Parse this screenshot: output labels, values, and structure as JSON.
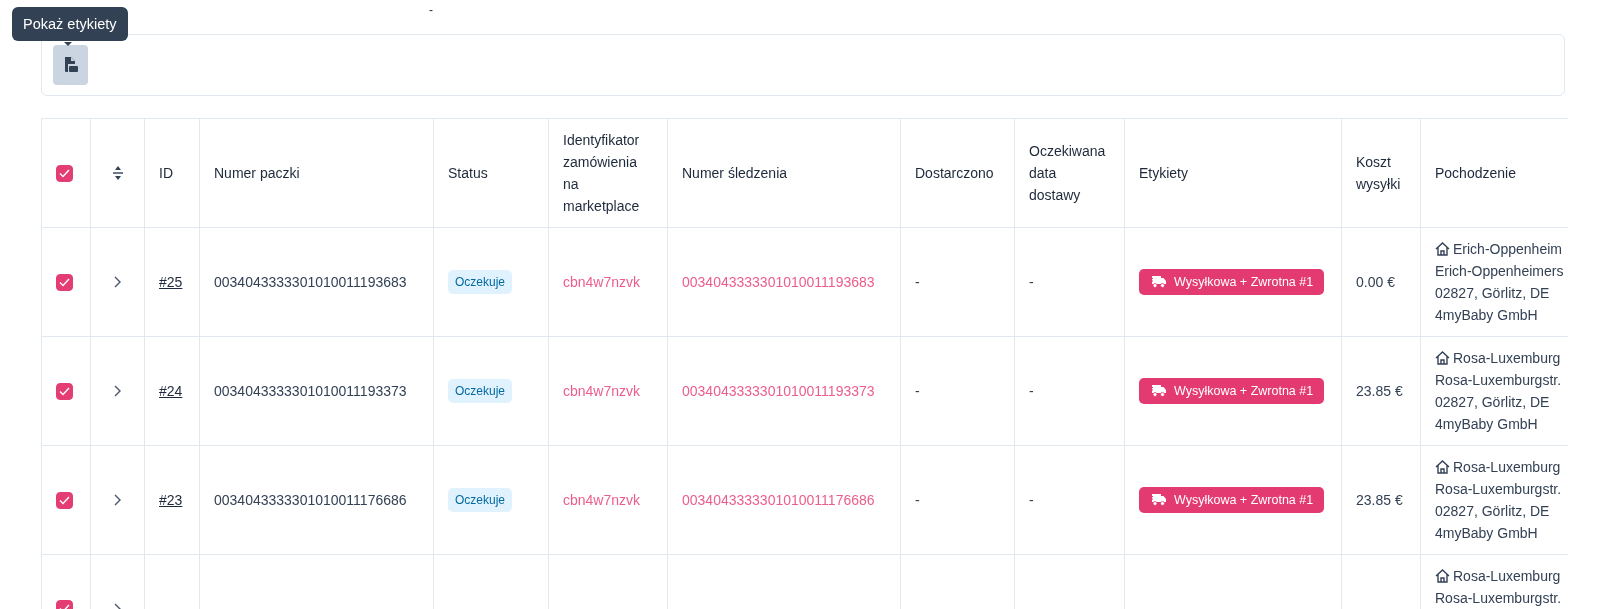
{
  "tooltip": {
    "text": "Pokaż etykiety"
  },
  "top_mark": "-",
  "table": {
    "select_all": {
      "checked": true
    },
    "columns": [
      "ID",
      "Numer paczki",
      "Status",
      "Identyfikator zamówienia na marketplace",
      "Numer śledzenia",
      "Dostarczono",
      "Oczekiwana data dostawy",
      "Etykiety",
      "Koszt wysyłki",
      "Pochodzenie"
    ],
    "rows": [
      {
        "checked": true,
        "expanded": false,
        "id": "#25",
        "parcel_number": "0034043333301010011193683",
        "status": "Oczekuje",
        "marketplace_order_id": "cbn4w7nzvk",
        "tracking_number": "0034043333301010011193683",
        "delivered": "-",
        "expected_delivery_date": "-",
        "labels": [
          "Wysyłkowa + Zwrotna #1"
        ],
        "shipping_cost": "0.00 €",
        "origin": [
          "Erich-Oppenheim",
          "Erich-Oppenheimers",
          "02827, Görlitz, DE",
          "4myBaby GmbH"
        ]
      },
      {
        "checked": true,
        "expanded": false,
        "id": "#24",
        "parcel_number": "0034043333301010011193373",
        "status": "Oczekuje",
        "marketplace_order_id": "cbn4w7nzvk",
        "tracking_number": "0034043333301010011193373",
        "delivered": "-",
        "expected_delivery_date": "-",
        "labels": [
          "Wysyłkowa + Zwrotna #1"
        ],
        "shipping_cost": "23.85 €",
        "origin": [
          "Rosa-Luxemburg",
          "Rosa-Luxemburgstr.",
          "02827, Görlitz, DE",
          "4myBaby GmbH"
        ]
      },
      {
        "checked": true,
        "expanded": false,
        "id": "#23",
        "parcel_number": "0034043333301010011176686",
        "status": "Oczekuje",
        "marketplace_order_id": "cbn4w7nzvk",
        "tracking_number": "0034043333301010011176686",
        "delivered": "-",
        "expected_delivery_date": "-",
        "labels": [
          "Wysyłkowa + Zwrotna #1"
        ],
        "shipping_cost": "23.85 €",
        "origin": [
          "Rosa-Luxemburg",
          "Rosa-Luxemburgstr.",
          "02827, Görlitz, DE",
          "4myBaby GmbH"
        ]
      },
      {
        "checked": true,
        "expanded": false,
        "origin": [
          "Rosa-Luxemburg",
          "Rosa-Luxemburgstr."
        ]
      }
    ]
  }
}
